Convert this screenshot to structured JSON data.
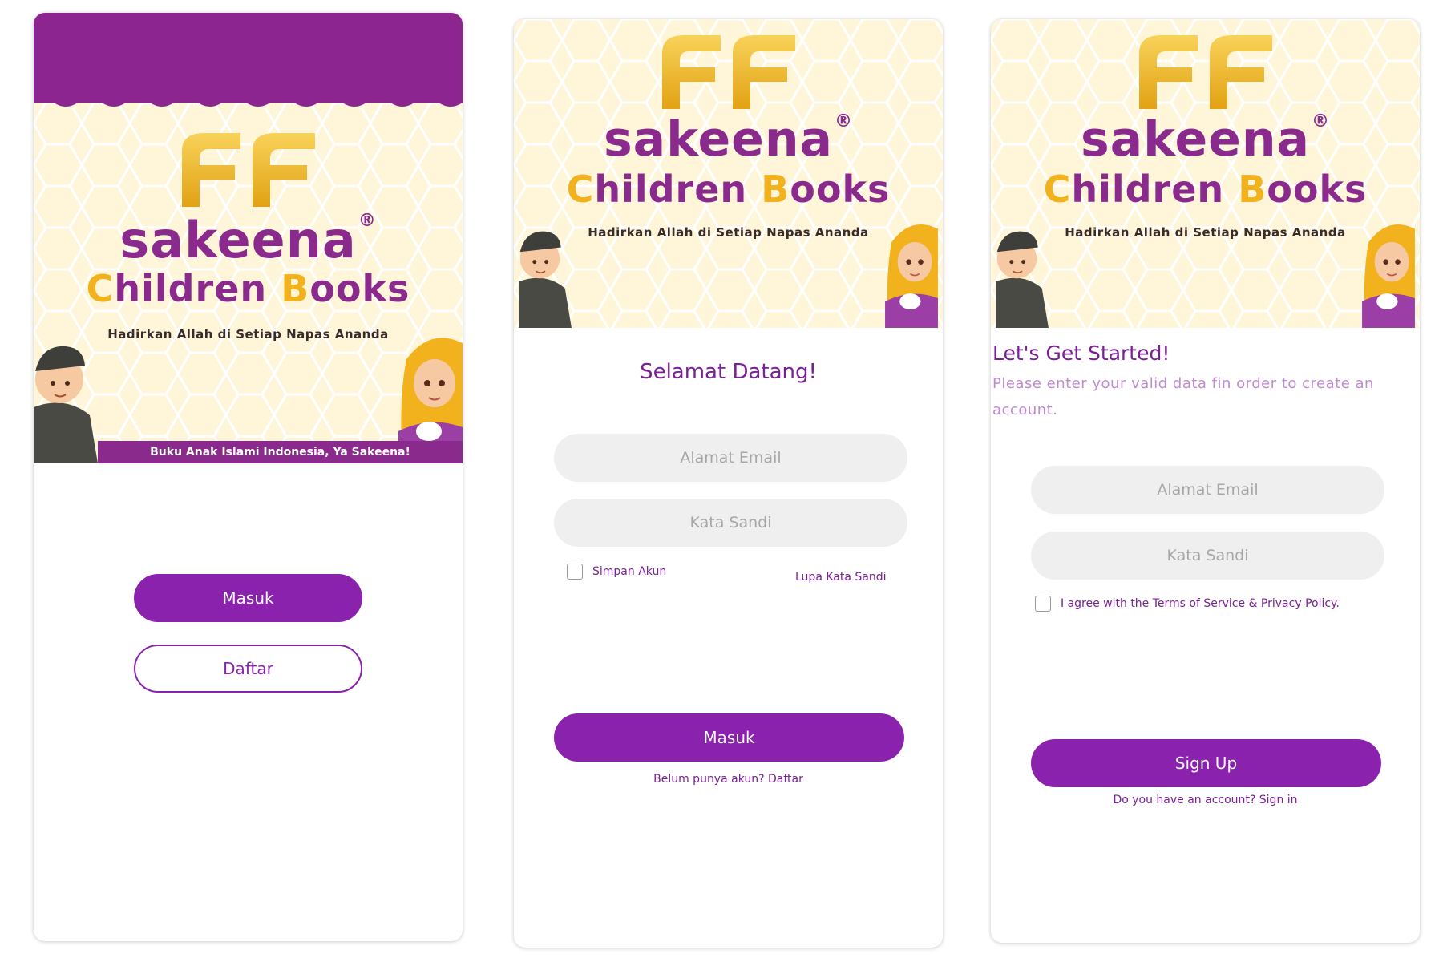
{
  "screens": [
    {
      "banner": {
        "brand": "sakeena",
        "brand_reg": "®",
        "subtitle_children": "Children",
        "subtitle_c": "C",
        "subtitle_hildren": "hildren",
        "subtitle_b": "B",
        "subtitle_ooks": "ooks",
        "tagline": "Hadirkan Allah di Setiap Napas Ananda",
        "ribbon": "Buku Anak Islami Indonesia, Ya Sakeena!"
      },
      "buttons": {
        "login": "Masuk",
        "register": "Daftar"
      }
    },
    {
      "banner": {
        "brand": "sakeena",
        "brand_reg": "®",
        "subtitle_c": "C",
        "subtitle_hildren": "hildren",
        "subtitle_b": "B",
        "subtitle_ooks": "ooks",
        "tagline": "Hadirkan Allah di Setiap Napas Ananda"
      },
      "title": "Selamat Datang!",
      "email_placeholder": "Alamat Email",
      "password_placeholder": "Kata Sandi",
      "remember_label": "Simpan Akun",
      "forgot_label": "Lupa Kata Sandi",
      "submit_label": "Masuk",
      "footer_text": "Belum punya akun? Daftar"
    },
    {
      "banner": {
        "brand": "sakeena",
        "brand_reg": "®",
        "subtitle_c": "C",
        "subtitle_hildren": "hildren",
        "subtitle_b": "B",
        "subtitle_ooks": "ooks",
        "tagline": "Hadirkan Allah di Setiap Napas Ananda"
      },
      "title": "Let's Get Started!",
      "description": "Please enter your valid data fin order to create an account.",
      "email_placeholder": "Alamat Email",
      "password_placeholder": "Kata Sandi",
      "agree_label": "I agree with the Terms of Service & Privacy Policy.",
      "submit_label": "Sign Up",
      "footer_text": "Do you have an account? Sign in"
    }
  ],
  "colors": {
    "brand_purple": "#8a22ad",
    "header_purple": "#8d2590",
    "gold": "#f1b21d",
    "banner_bg": "#fff6d9",
    "field_bg": "#efefef"
  }
}
